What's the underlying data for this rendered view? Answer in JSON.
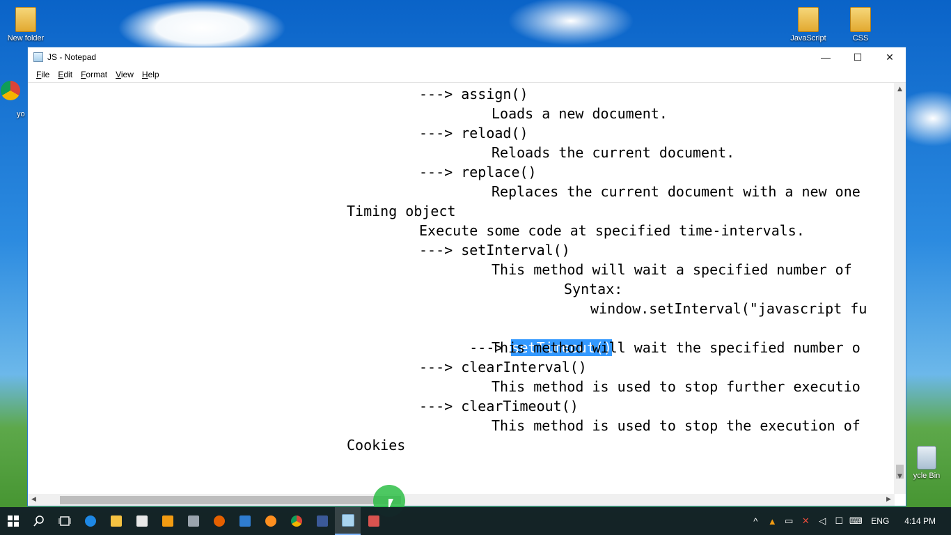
{
  "desktop": {
    "icons": [
      {
        "label": "New folder"
      },
      {
        "label": "JavaScript"
      },
      {
        "label": "CSS"
      },
      {
        "label": "ycle Bin"
      },
      {
        "label": "yo"
      }
    ]
  },
  "window": {
    "title": "JS - Notepad",
    "controls": {
      "minimize": "—",
      "maximize": "☐",
      "close": "✕"
    },
    "menu": [
      "File",
      "Edit",
      "Format",
      "View",
      "Help"
    ]
  },
  "editor": {
    "lines": [
      "---> assign()",
      "Loads a new document.",
      "---> reload()",
      "Reloads the current document.",
      "---> replace()",
      "Replaces the current document with a new one",
      "Timing object",
      "Execute some code at specified time-intervals.",
      "---> setInterval()",
      "This method will wait a specified number of",
      "Syntax:",
      "window.setInterval(\"javascript fu",
      "---> ",
      "setTimeout()",
      "This method will wait the specified number o",
      "---> clearInterval()",
      "This method is used to stop further executio",
      "---> clearTimeout()",
      "This method is used to stop the execution of",
      "Cookies"
    ],
    "selected_text": "setTimeout()"
  },
  "taskbar": {
    "tray": {
      "language": "ENG",
      "time": "4:14 PM"
    }
  },
  "colors": {
    "selection": "#3399ff",
    "taskbar": "#101a26",
    "window_border": "#2b78c9"
  }
}
